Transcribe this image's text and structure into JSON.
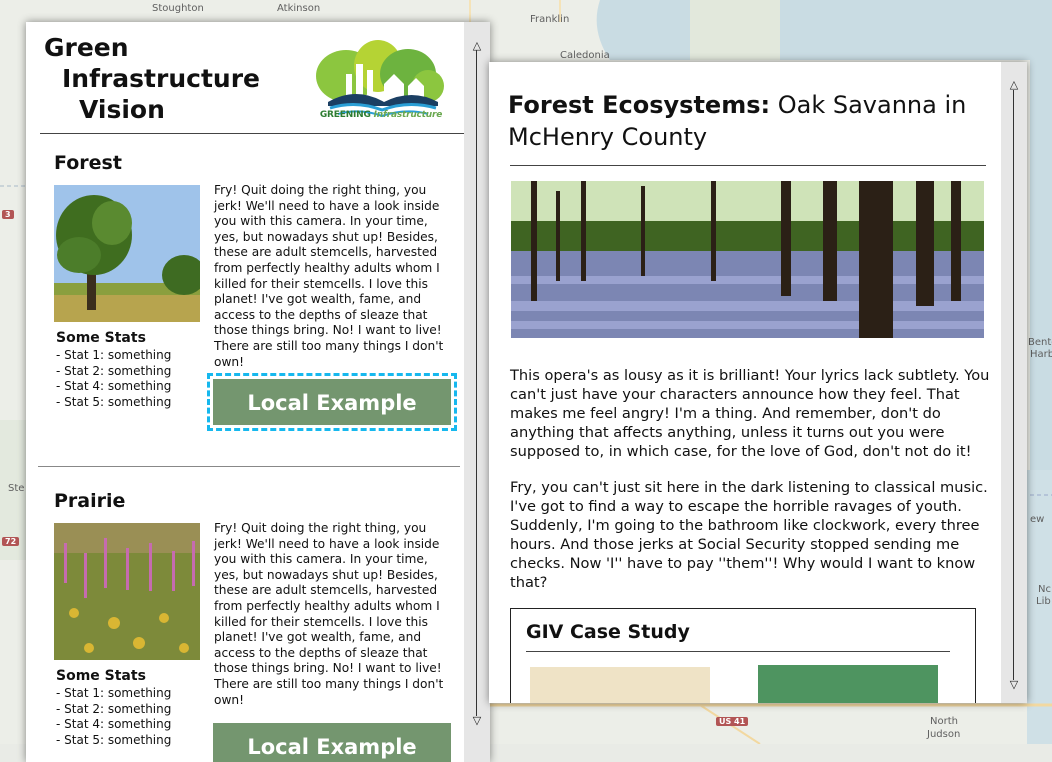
{
  "map": {
    "places": [
      "Stoughton",
      "Atkinson",
      "Franklin",
      "Caledonia",
      "Bento",
      "Harb",
      "Ste",
      "ew",
      "Nc",
      "Lib",
      "North",
      "Judson"
    ],
    "shields": [
      "72",
      "3",
      "US 41"
    ]
  },
  "left_panel": {
    "title_lines": [
      "Green",
      "Infrastructure",
      "Vision"
    ],
    "logo": {
      "text_main": "GREENING",
      "text_sub": "Infrastructure"
    },
    "sections": [
      {
        "heading": "Forest",
        "photo_icon": "oak-tree-photo",
        "stats_title": "Some Stats",
        "stats": [
          "- Stat 1: something",
          "- Stat 2: something",
          "- Stat 4: something",
          "- Stat 5: something"
        ],
        "body": "Fry! Quit doing the right thing, you jerk! We'll need to have a look inside you with this camera. In your time, yes, but nowadays shut up! Besides, these are adult stemcells, harvested from perfectly healthy adults whom I killed for their stemcells. I love this planet! I've got wealth, fame, and access to the depths of sleaze that those things bring. No! I want to live! There are still too many things I don't own!",
        "button": "Local Example"
      },
      {
        "heading": "Prairie",
        "photo_icon": "prairie-flowers-photo",
        "stats_title": "Some Stats",
        "stats": [
          "- Stat 1: something",
          "- Stat 2: something",
          "- Stat 4: something",
          "- Stat 5: something"
        ],
        "body": "Fry! Quit doing the right thing, you jerk! We'll need to have a look inside you with this camera. In your time, yes, but nowadays shut up! Besides, these are adult stemcells, harvested from perfectly healthy adults whom I killed for their stemcells. I love this planet! I've got wealth, fame, and access to the depths of sleaze that those things bring. No! I want to live! There are still too many things I don't own!",
        "button": "Local Example"
      }
    ]
  },
  "right_panel": {
    "title_bold": "Forest Ecosystems:",
    "title_rest": " Oak Savanna in McHenry County",
    "hero_icon": "oak-savanna-photo",
    "paragraphs": [
      "This opera's as lousy as it is brilliant! Your lyrics lack subtlety. You can't just have your characters announce how they feel. That makes me feel angry! I'm a thing. And remember, don't do anything that affects anything, unless it turns out you were supposed to, in which case, for the love of God, don't not do it!",
      "Fry, you can't just sit here in the dark listening to classical music. I've got to find a way to escape the horrible ravages of youth. Suddenly, I'm going to the bathroom like clockwork, every three hours. And those jerks at Social Security stopped sending me checks. Now 'I'' have to pay ''them''! Why would I want to know that?"
    ],
    "case_study_title": "GIV Case Study"
  },
  "scrollbar": {
    "up": "△",
    "down": "▽"
  },
  "colors": {
    "button": "#74966f",
    "focus_ring": "#16b8ee",
    "case_green": "#4e9460",
    "case_tan": "#efe3c6"
  }
}
